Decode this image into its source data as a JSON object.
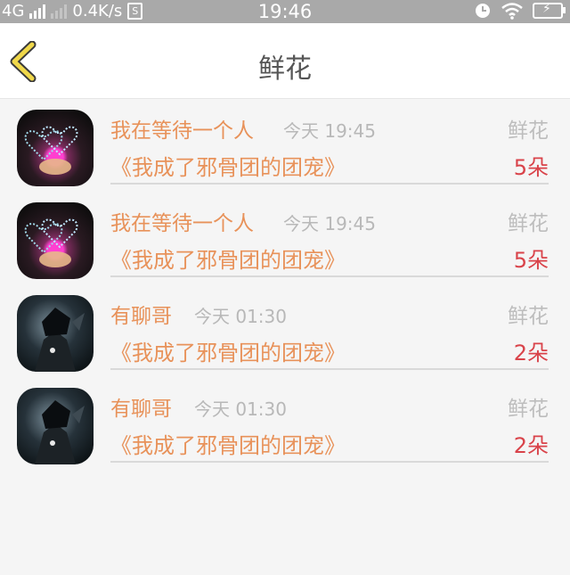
{
  "status_bar": {
    "network": "4G",
    "speed": "0.4K/s",
    "s_badge": "S",
    "time": "19:46",
    "icons": [
      "signal-icon",
      "alarm-icon",
      "wifi-icon",
      "battery-charging-icon"
    ]
  },
  "header": {
    "title": "鲜花",
    "back_icon": "back-chevron-icon"
  },
  "colors": {
    "accent_orange": "#e8925a",
    "count_red": "#d9434a",
    "back_yellow": "#f0d84a"
  },
  "records": [
    {
      "name": "我在等待一个人",
      "time": "今天 19:45",
      "gift": "鲜花",
      "book": "《我成了邪骨团的团宠》",
      "count": "5朵",
      "avatar": "hearts-avatar"
    },
    {
      "name": "我在等待一个人",
      "time": "今天 19:45",
      "gift": "鲜花",
      "book": "《我成了邪骨团的团宠》",
      "count": "5朵",
      "avatar": "hearts-avatar"
    },
    {
      "name": "有聊哥",
      "time": "今天 01:30",
      "gift": "鲜花",
      "book": "《我成了邪骨团的团宠》",
      "count": "2朵",
      "avatar": "dark-character-avatar"
    },
    {
      "name": "有聊哥",
      "time": "今天 01:30",
      "gift": "鲜花",
      "book": "《我成了邪骨团的团宠》",
      "count": "2朵",
      "avatar": "dark-character-avatar"
    }
  ]
}
